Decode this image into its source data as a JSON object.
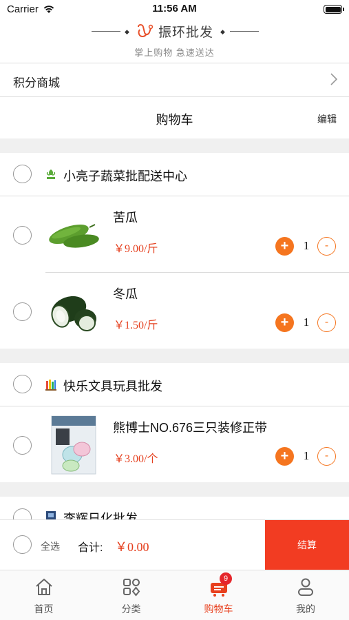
{
  "status_bar": {
    "carrier": "Carrier",
    "time": "11:56 AM"
  },
  "brand": {
    "name": "振环批发",
    "slogan": "掌上购物 急速送达"
  },
  "points_mall": {
    "label": "积分商城"
  },
  "cart": {
    "title": "购物车",
    "edit_label": "编辑"
  },
  "shops": [
    {
      "name": "小亮子蔬菜批配送中心",
      "icon": "vegetable-shop-icon",
      "products": [
        {
          "name": "苦瓜",
          "price": "￥9.00/斤",
          "quantity": "1",
          "plus": "+",
          "minus": "-"
        },
        {
          "name": "冬瓜",
          "price": "￥1.50/斤",
          "quantity": "1",
          "plus": "+",
          "minus": "-"
        }
      ]
    },
    {
      "name": "快乐文具玩具批发",
      "icon": "stationery-shop-icon",
      "products": [
        {
          "name": "熊博士NO.676三只装修正带",
          "price": "￥3.00/个",
          "quantity": "1",
          "plus": "+",
          "minus": "-"
        }
      ]
    },
    {
      "name": "李辉日化批发",
      "icon": "daily-goods-shop-icon",
      "products": []
    }
  ],
  "checkout": {
    "select_all": "全选",
    "total_label": "合计:",
    "total_value": "￥0.00",
    "checkout_label": "结算"
  },
  "tabbar": {
    "tabs": [
      {
        "label": "首页",
        "icon": "home-icon"
      },
      {
        "label": "分类",
        "icon": "category-icon"
      },
      {
        "label": "购物车",
        "icon": "cart-icon",
        "active": true
      },
      {
        "label": "我的",
        "icon": "profile-icon"
      }
    ],
    "cart_badge": "9"
  },
  "colors": {
    "accent": "#f5751f",
    "price": "#e5401f",
    "checkout": "#f23c22",
    "badge": "#e5262b"
  }
}
